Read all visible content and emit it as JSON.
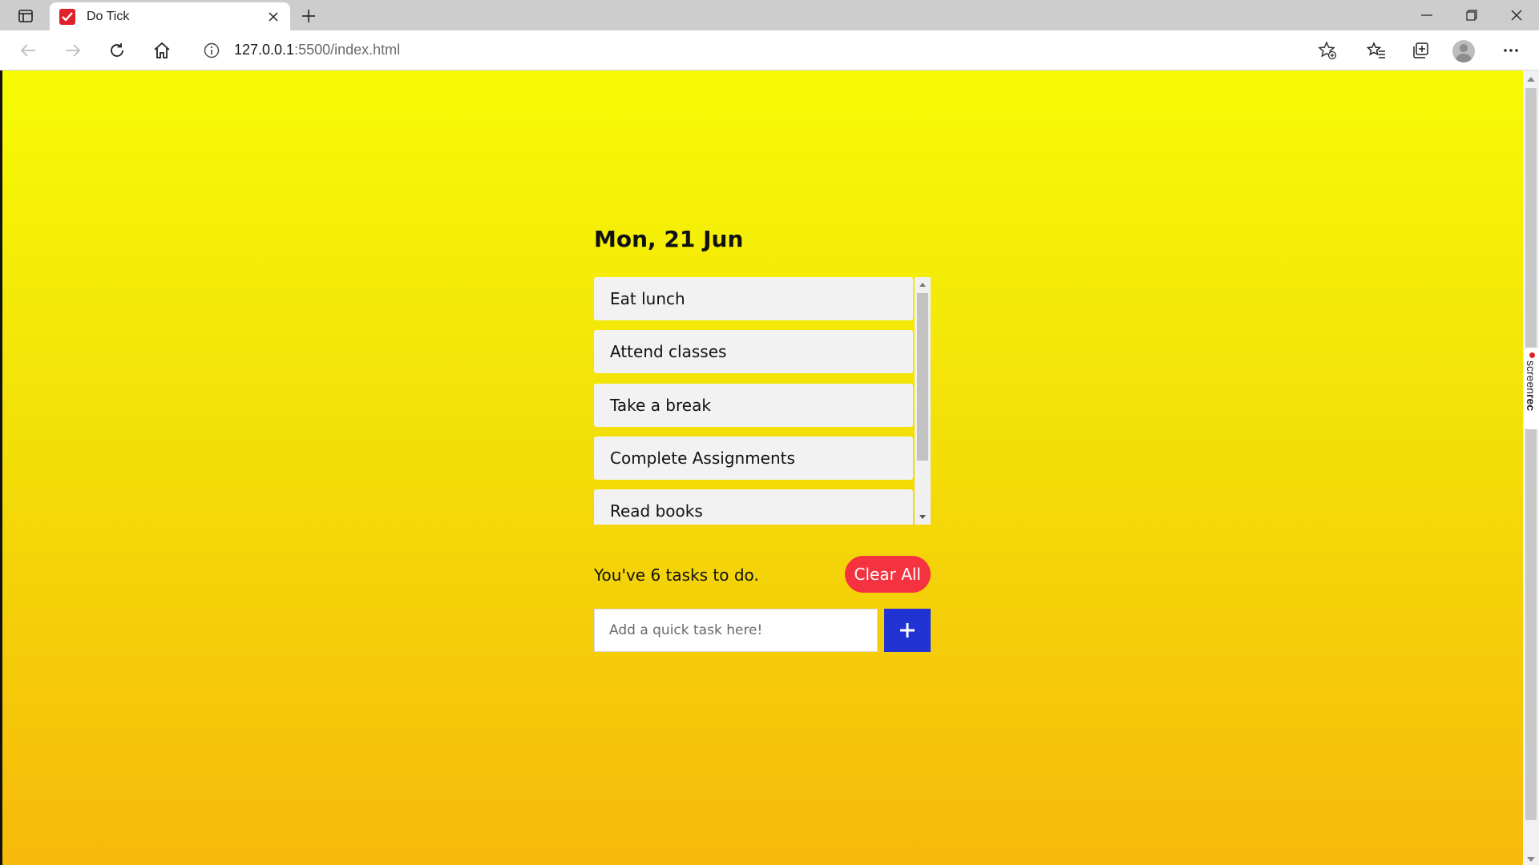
{
  "browser": {
    "tab_title": "Do Tick",
    "url_host": "127.0.0.1",
    "url_rest": ":5500/index.html",
    "icons": [
      "tab-actions-icon",
      "tab-favicon-icon",
      "close-tab-icon",
      "new-tab-icon",
      "minimize-icon",
      "restore-icon",
      "close-window-icon",
      "back-icon",
      "forward-icon",
      "refresh-icon",
      "home-icon",
      "site-info-icon",
      "add-favorite-icon",
      "favorites-icon",
      "collections-icon",
      "profile-avatar",
      "more-icon"
    ]
  },
  "overlay": {
    "recorder_badge_light": "screen",
    "recorder_badge_bold": "rec"
  },
  "app": {
    "date": "Mon, 21 Jun",
    "tasks": [
      {
        "label": "Eat lunch"
      },
      {
        "label": "Attend classes"
      },
      {
        "label": "Take a break"
      },
      {
        "label": "Complete Assignments"
      },
      {
        "label": "Read books"
      }
    ],
    "task_count_text": "You've 6 tasks to do.",
    "clear_all_label": "Clear All",
    "input_placeholder": "Add a quick task here!",
    "input_value": "",
    "add_button_symbol": "+"
  },
  "colors": {
    "gradient_top": "#f7fb05",
    "gradient_bottom": "#f7b90a",
    "clear_all_bg": "#f5323f",
    "add_button_bg": "#2233d4",
    "task_bg": "#f2f2f2"
  }
}
